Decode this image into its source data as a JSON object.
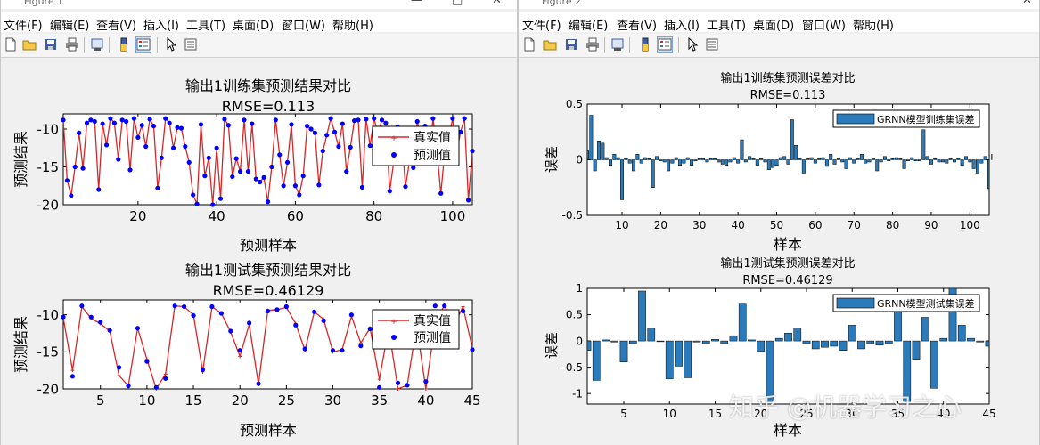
{
  "figure1": {
    "title_text": "Figure 1",
    "menu": [
      "文件(F)",
      "编辑(E)",
      "查看(V)",
      "插入(I)",
      "工具(T)",
      "桌面(D)",
      "窗口(W)",
      "帮助(H)"
    ],
    "toolbar_icons": [
      "new-file-icon",
      "open-folder-icon",
      "save-icon",
      "print-icon",
      "print-preview-icon",
      "colorbar-icon",
      "legend-icon",
      "pointer-icon",
      "edit-plot-icon"
    ]
  },
  "figure2": {
    "title_text": "Figure 2",
    "menu": [
      "文件(F)",
      "编辑(E)",
      "查看(V)",
      "插入(I)",
      "工具(T)",
      "桌面(D)",
      "窗口(W)",
      "帮助(H)"
    ],
    "toolbar_icons": [
      "new-file-icon",
      "open-folder-icon",
      "save-icon",
      "print-icon",
      "print-preview-icon",
      "colorbar-icon",
      "legend-icon",
      "pointer-icon",
      "edit-plot-icon"
    ]
  },
  "watermark": "知乎 @机器学习之心",
  "chart_data": [
    {
      "id": "train_compare",
      "type": "line",
      "title": "输出1训练集预测结果对比",
      "subtitle": "RMSE=0.113",
      "xlabel": "预测样本",
      "ylabel": "预测结果",
      "xlim": [
        1,
        105
      ],
      "ylim": [
        -20,
        -8
      ],
      "xticks": [
        20,
        40,
        60,
        80,
        100
      ],
      "yticks": [
        -10,
        -15,
        -20
      ],
      "legend": [
        "真实值",
        "预测值"
      ],
      "legend_position": "top-right",
      "colors": {
        "true": "#d62728",
        "pred": "#0000ff"
      },
      "series": [
        {
          "name": "真实值",
          "values": [
            -8.8,
            -16.8,
            -18.8,
            -15,
            -10.5,
            -15.2,
            -9.2,
            -8.8,
            -9,
            -18,
            -9.3,
            -12.1,
            -8.6,
            -9.2,
            -14,
            -8.8,
            -9,
            -15.4,
            -8.6,
            -11.1,
            -9.5,
            -12.3,
            -8.7,
            -9.6,
            -17.8,
            -13.8,
            -8.6,
            -9.2,
            -12.5,
            -9.8,
            -9.9,
            -12.3,
            -14.4,
            -18.7,
            -19.9,
            -9.4,
            -16.2,
            -13.8,
            -20,
            -12.5,
            -19.2,
            -8.7,
            -9.5,
            -16.3,
            -13.9,
            -15.6,
            -8.8,
            -15.6,
            -9.3,
            -16.6,
            -17,
            -16.4,
            -19.6,
            -15,
            -8.8,
            -13.4,
            -17.5,
            -14.4,
            -9.4,
            -17.5,
            -18.7,
            -16.2,
            -9.6,
            -10,
            -10.5,
            -17.4,
            -12.9,
            -10.8,
            -8.6,
            -10.4,
            -12.3,
            -9.3,
            -15.6,
            -12.4,
            -8.9,
            -8.8,
            -17.7,
            -8.7,
            -12.2,
            -8.6,
            -10.6,
            -8.8,
            -9.2,
            -18.2,
            -14.4,
            -9.7,
            -10.4,
            -17.6,
            -14.4,
            -15.1,
            -9,
            -11.3,
            -9.6,
            -14,
            -8.6,
            -12.9,
            -18.5,
            -13,
            -11.2,
            -8.6,
            -13.1,
            -10.4,
            -8.6,
            -19.4,
            -12.9
          ]
        },
        {
          "name": "预测值",
          "values": [
            -8.8,
            -16.8,
            -18.8,
            -15,
            -10.5,
            -15.2,
            -9.2,
            -8.8,
            -9,
            -18,
            -9.3,
            -12.1,
            -8.6,
            -9.2,
            -14,
            -8.8,
            -9,
            -15.4,
            -8.6,
            -11.1,
            -9.5,
            -12.3,
            -8.7,
            -9.6,
            -17.8,
            -13.8,
            -8.6,
            -9.2,
            -12.5,
            -9.8,
            -9.9,
            -12.3,
            -14.4,
            -18.7,
            -19.9,
            -9.4,
            -16.2,
            -13.8,
            -20,
            -12.5,
            -19.2,
            -8.7,
            -9.5,
            -16.3,
            -13.9,
            -15.6,
            -8.8,
            -15.6,
            -9.3,
            -16.6,
            -17,
            -16.4,
            -19.6,
            -15,
            -8.8,
            -13.4,
            -17.5,
            -14.4,
            -9.4,
            -17.5,
            -18.7,
            -16.2,
            -9.6,
            -10,
            -10.5,
            -17.4,
            -12.9,
            -10.8,
            -8.6,
            -10.4,
            -12.3,
            -9.3,
            -15.6,
            -12.4,
            -8.9,
            -8.8,
            -17.7,
            -8.7,
            -12.2,
            -8.6,
            -10.6,
            -8.8,
            -9.2,
            -18.2,
            -14.4,
            -9.7,
            -10.4,
            -17.6,
            -14.4,
            -15.1,
            -9,
            -11.3,
            -9.6,
            -14,
            -8.6,
            -12.9,
            -18.5,
            -13,
            -11.2,
            -8.6,
            -13.1,
            -10.4,
            -8.6,
            -19.4,
            -12.9
          ]
        }
      ]
    },
    {
      "id": "test_compare",
      "type": "line",
      "title": "输出1测试集预测结果对比",
      "subtitle": "RMSE=0.46129",
      "xlabel": "预测样本",
      "ylabel": "预测结果",
      "xlim": [
        1,
        45
      ],
      "ylim": [
        -20,
        -8
      ],
      "xticks": [
        5,
        10,
        15,
        20,
        25,
        30,
        35,
        40,
        45
      ],
      "yticks": [
        -10,
        -15,
        -20
      ],
      "legend": [
        "真实值",
        "预测值"
      ],
      "legend_position": "top-right",
      "colors": {
        "true": "#d62728",
        "pred": "#0000ff"
      },
      "series": [
        {
          "name": "真实值",
          "values": [
            -10.4,
            -17.5,
            -8.9,
            -10.5,
            -11.2,
            -12.2,
            -18.2,
            -19.6,
            -11.8,
            -16,
            -20,
            -18,
            -8.8,
            -8.9,
            -10,
            -17.7,
            -8.9,
            -9.8,
            -12.3,
            -15.6,
            -11.3,
            -19.4,
            -9.4,
            -9.3,
            -9,
            -11.2,
            -14.8,
            -9.6,
            -10.6,
            -15,
            -14.7,
            -10.2,
            -13.8,
            -11.8,
            -18.7,
            -11.8,
            -20,
            -19.5,
            -11.4,
            -20,
            -11.2,
            -8.7,
            -11.5,
            -8.9,
            -14.5
          ]
        },
        {
          "name": "预测值",
          "values": [
            -10.3,
            -18.3,
            -8.8,
            -10.3,
            -11,
            -12.1,
            -17.1,
            -19.6,
            -11.8,
            -16.3,
            -19.8,
            -18.6,
            -8.8,
            -8.9,
            -10.1,
            -17.4,
            -8.9,
            -9.8,
            -12.2,
            -14.8,
            -11.1,
            -19.3,
            -9.5,
            -9.3,
            -8.9,
            -11.4,
            -14.6,
            -9.6,
            -10.8,
            -14.8,
            -14.8,
            -10,
            -14.2,
            -11.9,
            -19.8,
            -12,
            -19.2,
            -19.5,
            -11.1,
            -19,
            -8.8,
            -8.8,
            -10.6,
            -9.5,
            -14.7
          ]
        }
      ]
    },
    {
      "id": "train_error",
      "type": "bar",
      "title": "输出1训练集预测误差对比",
      "subtitle": "RMSE=0.113",
      "xlabel": "样本",
      "ylabel": "误差",
      "xlim": [
        1,
        105
      ],
      "ylim": [
        -0.5,
        0.5
      ],
      "xticks": [
        10,
        20,
        30,
        40,
        50,
        60,
        70,
        80,
        90,
        100
      ],
      "yticks": [
        0.5,
        0,
        -0.5
      ],
      "legend": [
        "GRNN模型训练集误差"
      ],
      "legend_position": "top-right",
      "colors": {
        "bar": "#2b7bba"
      },
      "series": [
        {
          "name": "GRNN模型训练集误差",
          "values": [
            0.08,
            0.4,
            -0.1,
            0.17,
            0.15,
            0.02,
            -0.05,
            0.05,
            0.02,
            -0.36,
            0.01,
            -0.03,
            -0.1,
            0.05,
            -0.03,
            0.02,
            0.01,
            -0.25,
            0.03,
            -0.01,
            -0.02,
            -0.1,
            -0.03,
            0.02,
            -0.05,
            -0.03,
            0.02,
            -0.05,
            -0.01,
            0.01,
            0.01,
            -0.02,
            0.01,
            0.01,
            -0.02,
            -0.04,
            -0.05,
            -0.02,
            0.02,
            -0.03,
            0.18,
            -0.02,
            0.03,
            0.01,
            -0.05,
            0.01,
            -0.02,
            -0.09,
            -0.07,
            -0.05,
            0.02,
            0.03,
            -0.04,
            0.36,
            0.13,
            0.01,
            -0.12,
            0.01,
            0.02,
            -0.03,
            0.01,
            0.02,
            -0.06,
            0.05,
            -0.04,
            0.01,
            -0.02,
            -0.08,
            0.02,
            -0.03,
            0.01,
            0.05,
            -0.03,
            -0.02,
            0.01,
            -0.1,
            -0.02,
            0.03,
            -0.01,
            0.01,
            0.02,
            0.01,
            -0.08,
            -0.01,
            0.02,
            -0.01,
            -0.01,
            0.27,
            0.03,
            -0.04,
            0.01,
            -0.02,
            -0.02,
            -0.03,
            0.01,
            -0.02,
            0.01,
            -0.05,
            0.03,
            -0.02,
            -0.08,
            -0.12,
            -0.03,
            0.03,
            -0.26,
            0.05
          ]
        }
      ]
    },
    {
      "id": "test_error",
      "type": "bar",
      "title": "输出1测试集预测误差对比",
      "subtitle": "RMSE=0.46129",
      "xlabel": "样本",
      "ylabel": "误差",
      "xlim": [
        1,
        45
      ],
      "ylim": [
        -1.2,
        1
      ],
      "xticks": [
        5,
        10,
        15,
        20,
        25,
        30,
        35,
        40,
        45
      ],
      "yticks": [
        1,
        0.5,
        0,
        -0.5,
        -1
      ],
      "legend": [
        "GRNN模型测试集误差"
      ],
      "legend_position": "top-right",
      "colors": {
        "bar": "#2b7bba"
      },
      "series": [
        {
          "name": "GRNN模型测试集误差",
          "values": [
            -0.18,
            -0.75,
            0.02,
            -0.02,
            -0.4,
            -0.05,
            0.95,
            0.25,
            0,
            -0.72,
            -0.48,
            -0.7,
            -0.02,
            -0.05,
            0.03,
            -0.05,
            0.1,
            0.7,
            0.02,
            -0.2,
            -1.15,
            0.05,
            0.15,
            0.25,
            -0.05,
            -0.15,
            -0.12,
            -0.1,
            -0.18,
            0.3,
            -0.15,
            -0.05,
            -0.08,
            -0.05,
            0.75,
            -1.15,
            -0.35,
            0.45,
            -0.9,
            0.05,
            1.0,
            0.3,
            0.05,
            -0.02,
            -0.1
          ]
        }
      ]
    }
  ]
}
